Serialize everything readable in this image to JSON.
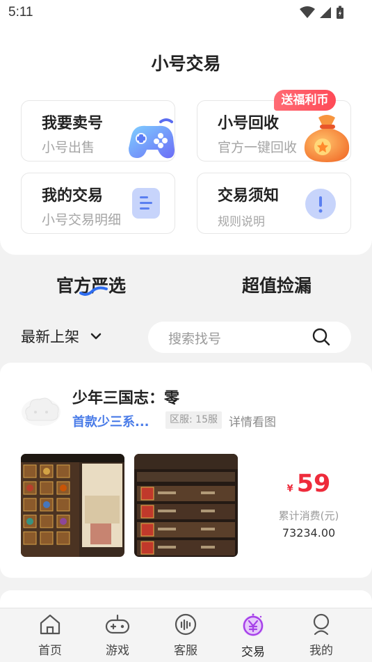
{
  "status_bar": {
    "time": "5:11"
  },
  "page_title": "小号交易",
  "cards": {
    "sell": {
      "title": "我要卖号",
      "subtitle": "小号出售",
      "icon": "gamepad-icon"
    },
    "recycle": {
      "title": "小号回收",
      "subtitle": "官方一键回收",
      "icon": "money-bag-icon",
      "badge": "送福利币"
    },
    "my_trades": {
      "title": "我的交易",
      "subtitle": "小号交易明细",
      "icon": "list-icon"
    },
    "notice": {
      "title": "交易须知",
      "subtitle": "规则说明",
      "icon": "exclamation-icon"
    }
  },
  "tabs": [
    {
      "label": "官方严选",
      "active": true
    },
    {
      "label": "超值捡漏",
      "active": false
    }
  ],
  "filter": {
    "selected": "最新上架"
  },
  "search": {
    "placeholder": "搜索找号"
  },
  "listing": {
    "game_name": "少年三国志：零",
    "description": "首款少三系...",
    "server_tag": "区服: 15服",
    "detail_link": "详情看图",
    "price_symbol": "¥",
    "price": "59",
    "spend_label": "累计消费(元)",
    "spend_value": "73234.00"
  },
  "bottom_nav": [
    {
      "label": "首页",
      "icon": "home-icon"
    },
    {
      "label": "游戏",
      "icon": "gamepad-nav-icon"
    },
    {
      "label": "客服",
      "icon": "headset-icon"
    },
    {
      "label": "交易",
      "icon": "yen-icon",
      "active": true
    },
    {
      "label": "我的",
      "icon": "user-icon"
    }
  ],
  "colors": {
    "accent_price": "#ee2b3b",
    "link_blue": "#4a7ce8",
    "active_nav": "#a640e8",
    "badge": "#ff4a57"
  }
}
